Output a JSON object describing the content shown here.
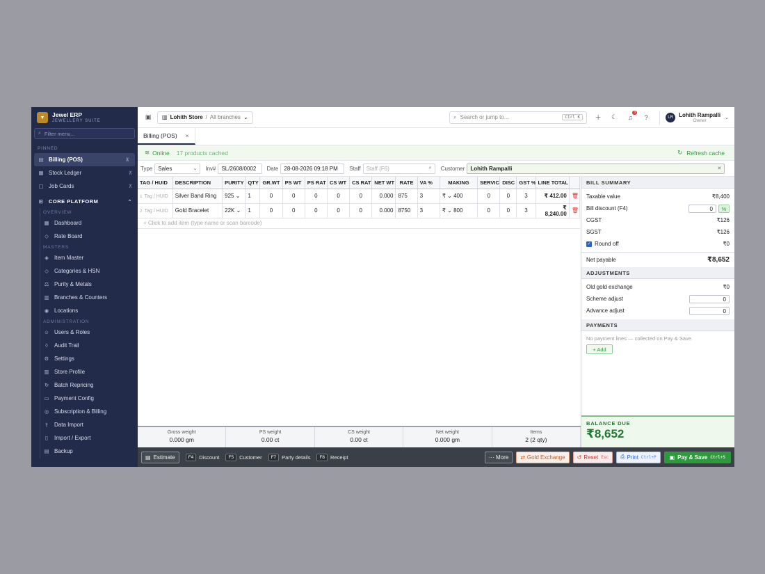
{
  "brand": {
    "name": "Jewel ERP",
    "tagline": "JEWELLERY SUITE",
    "logo": "▼"
  },
  "sidebar": {
    "filter_placeholder": "Filter menu...",
    "pinned_label": "PINNED",
    "pinned": [
      {
        "label": "Billing (POS)",
        "icon": "receipt-icon"
      },
      {
        "label": "Stock Ledger",
        "icon": "ledger-icon"
      },
      {
        "label": "Job Cards",
        "icon": "card-icon"
      }
    ],
    "group_label": "CORE PLATFORM",
    "overview_label": "OVERVIEW",
    "overview": [
      {
        "label": "Dashboard"
      },
      {
        "label": "Rate Board"
      }
    ],
    "masters_label": "MASTERS",
    "masters": [
      {
        "label": "Item Master"
      },
      {
        "label": "Categories & HSN"
      },
      {
        "label": "Purity & Metals"
      },
      {
        "label": "Branches & Counters"
      },
      {
        "label": "Locations"
      }
    ],
    "admin_label": "ADMINISTRATION",
    "admin": [
      {
        "label": "Users & Roles"
      },
      {
        "label": "Audit Trail"
      },
      {
        "label": "Settings"
      },
      {
        "label": "Store Profile"
      },
      {
        "label": "Batch Repricing"
      },
      {
        "label": "Payment Config"
      },
      {
        "label": "Subscription & Billing"
      },
      {
        "label": "Data Import"
      },
      {
        "label": "Import / Export"
      },
      {
        "label": "Backup"
      }
    ]
  },
  "topbar": {
    "store": "Lohith Store",
    "sep": "/",
    "branches": "All branches",
    "search_placeholder": "Search or jump to...",
    "search_kbd": "Ctrl K",
    "notif_count": "3",
    "user_name": "Lohith Rampalli",
    "user_role": "Owner",
    "user_initials": "LR"
  },
  "tab": {
    "label": "Billing (POS)"
  },
  "status": {
    "online": "Online",
    "cached": "17 products cached",
    "refresh": "Refresh cache"
  },
  "meta": {
    "type_label": "Type",
    "type_value": "Sales",
    "inv_label": "Inv#",
    "inv_value": "SL/2608/0002",
    "date_label": "Date",
    "date_value": "28-08-2026 09:18 PM",
    "staff_label": "Staff",
    "staff_placeholder": "Staff (F6)",
    "customer_label": "Customer",
    "customer_value": "Lohith Rampalli"
  },
  "grid": {
    "headers": [
      "TAG / HUID",
      "DESCRIPTION",
      "PURITY",
      "QTY",
      "GR.WT",
      "PS WT",
      "PS RAT",
      "CS WT",
      "CS RAT",
      "NET WT",
      "RATE",
      "VA %",
      "MAKING",
      "SERVIC",
      "DISC",
      "GST %",
      "LINE TOTAL"
    ],
    "rows": [
      {
        "num": "1",
        "tag": "Tag / HUID",
        "desc": "Silver Band Ring",
        "purity": "925",
        "qty": "1",
        "grwt": "0",
        "pswt": "0",
        "psrat": "0",
        "cswt": "0",
        "csrat": "0",
        "netwt": "0.000",
        "rate": "875",
        "va": "3",
        "making_cur": "₹",
        "making": "400",
        "serv": "0",
        "disc": "0",
        "gst": "3",
        "total": "₹ 412.00"
      },
      {
        "num": "2",
        "tag": "Tag / HUID",
        "desc": "Gold Bracelet",
        "purity": "22K",
        "qty": "1",
        "grwt": "0",
        "pswt": "0",
        "psrat": "0",
        "cswt": "0",
        "csrat": "0",
        "netwt": "0.000",
        "rate": "8750",
        "va": "3",
        "making_cur": "₹",
        "making": "800",
        "serv": "0",
        "disc": "0",
        "gst": "3",
        "total_a": "₹",
        "total_b": "8,240.00"
      }
    ],
    "add_hint": "+ Click to add item (type name or scan barcode)"
  },
  "totals": [
    {
      "label": "Gross weight",
      "value": "0.000 gm"
    },
    {
      "label": "PS weight",
      "value": "0.00 ct"
    },
    {
      "label": "CS weight",
      "value": "0.00 ct"
    },
    {
      "label": "Net weight",
      "value": "0.000 gm"
    },
    {
      "label": "Items",
      "value": "2 (2 qty)"
    }
  ],
  "summary": {
    "title": "BILL SUMMARY",
    "taxable_label": "Taxable value",
    "taxable": "₹8,400",
    "discount_label": "Bill discount (F4)",
    "discount": "0",
    "pct": "%",
    "cgst_label": "CGST",
    "cgst": "₹126",
    "sgst_label": "SGST",
    "sgst": "₹126",
    "round_label": "Round off",
    "round": "₹0",
    "net_label": "Net payable",
    "net": "₹8,652",
    "adj_title": "ADJUSTMENTS",
    "oldgold_label": "Old gold exchange",
    "oldgold": "₹0",
    "scheme_label": "Scheme adjust",
    "scheme": "0",
    "advance_label": "Advance adjust",
    "advance": "0",
    "pay_title": "PAYMENTS",
    "pay_note": "No payment lines — collected on Pay & Save.",
    "add": "+ Add",
    "balance_label": "BALANCE DUE",
    "balance": "₹8,652"
  },
  "footer": {
    "estimate": "Estimate",
    "keys": [
      {
        "k": "F4",
        "l": "Discount"
      },
      {
        "k": "F5",
        "l": "Customer"
      },
      {
        "k": "F7",
        "l": "Party details"
      },
      {
        "k": "F8",
        "l": "Receipt"
      }
    ],
    "more": "··· More",
    "gold": "Gold Exchange",
    "reset": "Reset",
    "reset_k": "Esc",
    "print": "Print",
    "print_k": "Ctrl+P",
    "pay": "Pay & Save",
    "pay_k": "Ctrl+S"
  }
}
